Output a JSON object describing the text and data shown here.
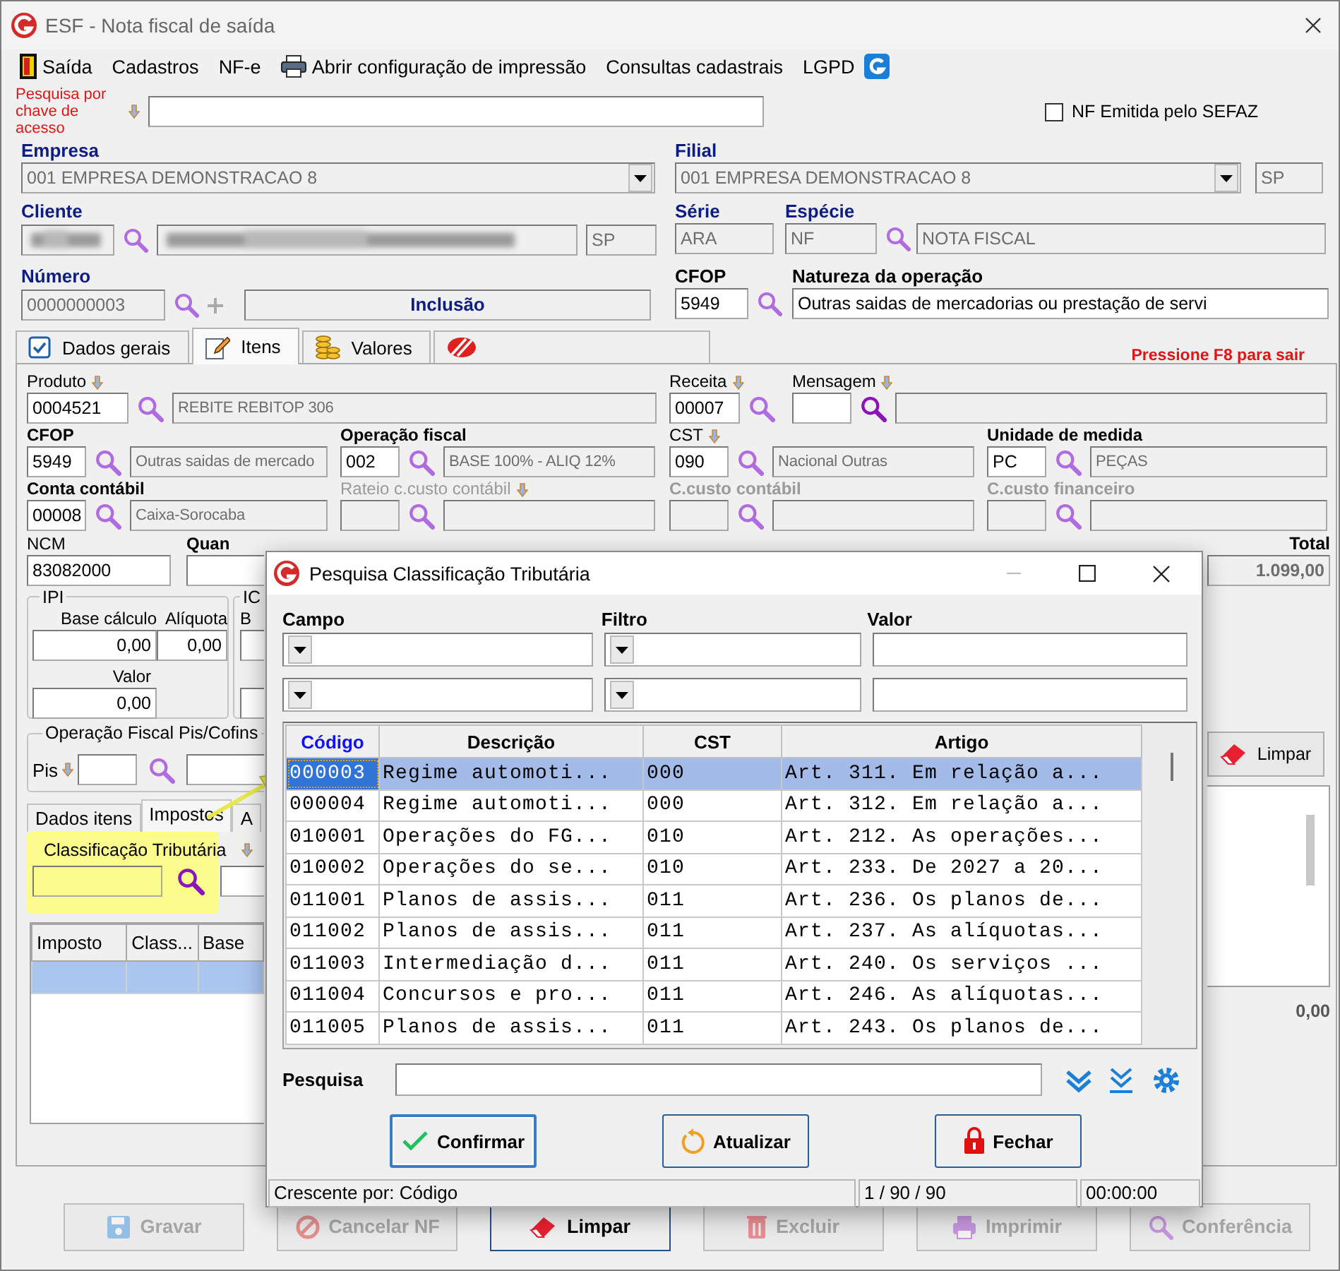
{
  "window": {
    "title": "ESF - Nota fiscal de saída"
  },
  "menu": [
    {
      "label": "Saída",
      "kind": "exit"
    },
    {
      "label": "Cadastros",
      "kind": "plain"
    },
    {
      "label": "NF-e",
      "kind": "plain"
    },
    {
      "label": "Abrir configuração de impressão",
      "kind": "print"
    },
    {
      "label": "Consultas cadastrais",
      "kind": "plain"
    },
    {
      "label": "LGPD",
      "kind": "plain"
    }
  ],
  "access_key": {
    "label": "Pesquisa por chave de acesso"
  },
  "sefaz": {
    "label": "NF Emitida pelo SEFAZ",
    "checked": false
  },
  "empresa": {
    "label": "Empresa",
    "value": "001 EMPRESA DEMONSTRACAO 8"
  },
  "filial": {
    "label": "Filial",
    "value": "001 EMPRESA DEMONSTRACAO 8",
    "uf": "SP"
  },
  "cliente": {
    "label": "Cliente",
    "uf": "SP"
  },
  "serie": {
    "label": "Série",
    "value": "ARA"
  },
  "especie": {
    "label": "Espécie",
    "value": "NF",
    "description": "NOTA FISCAL"
  },
  "numero": {
    "label": "Número",
    "value": "0000000003",
    "status": "Inclusão"
  },
  "cfop": {
    "label": "CFOP",
    "value": "5949"
  },
  "natureza": {
    "label": "Natureza da operação",
    "value": "Outras saidas de mercadorias ou prestação de servi"
  },
  "tabs": [
    {
      "label": "Dados gerais",
      "kind": "check",
      "selected": false
    },
    {
      "label": "Itens",
      "kind": "edit",
      "selected": true
    },
    {
      "label": "Valores",
      "kind": "coins",
      "selected": false
    },
    {
      "kind": "logo",
      "selected": false
    }
  ],
  "hint": "Pressione F8 para sair",
  "item_rows": [
    [
      {
        "label": "Produto",
        "required": false,
        "searchable": true,
        "disabled": false,
        "code": "0004521",
        "description": "REBITE REBITOP 306"
      },
      {
        "label": "Receita",
        "required": false,
        "searchable": true,
        "disabled": false,
        "code": "00007"
      },
      {
        "label": "Mensagem",
        "required": false,
        "searchable": true,
        "disabled": false
      }
    ],
    [
      {
        "label": "CFOP",
        "required": true,
        "searchable": false,
        "disabled": false,
        "code": "5949",
        "description": "Outras saidas de mercado"
      },
      {
        "label": "Operação fiscal",
        "required": true,
        "searchable": false,
        "disabled": false,
        "code": "002",
        "description": "BASE 100% - ALIQ 12%"
      },
      {
        "label": "CST",
        "required": false,
        "searchable": true,
        "disabled": false,
        "code": "090",
        "description": "Nacional Outras"
      },
      {
        "label": "Unidade de medida",
        "required": true,
        "searchable": false,
        "disabled": false,
        "code": "PC",
        "description": "PEÇAS"
      }
    ],
    [
      {
        "label": "Conta contábil",
        "required": true,
        "searchable": false,
        "disabled": false,
        "code": "00008",
        "description": "Caixa-Sorocaba"
      },
      {
        "label": "Rateio c.custo contábil",
        "required": false,
        "searchable": true,
        "disabled": true
      },
      {
        "label": "C.custo contábil",
        "required": true,
        "searchable": false,
        "disabled": true
      },
      {
        "label": "C.custo financeiro",
        "required": true,
        "searchable": false,
        "disabled": true
      }
    ]
  ],
  "ncm": {
    "label": "NCM",
    "value": "83082000"
  },
  "quantity_label": "Quan",
  "total": {
    "label": "Total",
    "value": "1.099,00"
  },
  "ipi": {
    "title": "IPI",
    "base_label": "Base cálculo",
    "base": "0,00",
    "rate_label": "Alíquota",
    "rate": "0,00",
    "value_label": "Valor",
    "value": "0,00"
  },
  "icms": {
    "title": "IC",
    "label": "B"
  },
  "pis_cofins": {
    "title": "Operação Fiscal Pis/Cofins",
    "pis_label": "Pis"
  },
  "clear_button": "Limpar",
  "item_tabs": [
    {
      "label": "Dados itens",
      "selected": false
    },
    {
      "label": "Impostos",
      "selected": true
    },
    {
      "label": "A",
      "selected": false
    }
  ],
  "classification": {
    "label": "Classificação Tributária",
    "highlighted": true
  },
  "tax_grid": {
    "columns": [
      "Imposto",
      "Class...",
      "Base"
    ],
    "rows": [
      {
        "selected": true
      }
    ]
  },
  "footer_total": "0,00",
  "actions": [
    {
      "label": "Gravar",
      "kind": "save",
      "disabled": true
    },
    {
      "label": "Cancelar NF",
      "kind": "cancel",
      "disabled": true
    },
    {
      "label": "Limpar",
      "kind": "clear",
      "disabled": false
    },
    {
      "label": "Excluir",
      "kind": "delete",
      "disabled": true
    },
    {
      "label": "Imprimir",
      "kind": "print",
      "disabled": true
    },
    {
      "label": "Conferência",
      "kind": "search",
      "disabled": true
    }
  ],
  "dialog": {
    "title": "Pesquisa Classificação Tributária",
    "filter_labels": [
      "Campo",
      "Filtro",
      "Valor"
    ],
    "columns": [
      {
        "label": "Código",
        "sorted": true
      },
      {
        "label": "Descrição",
        "sorted": false
      },
      {
        "label": "CST",
        "sorted": false
      },
      {
        "label": "Artigo",
        "sorted": false
      }
    ],
    "rows": [
      {
        "cells": [
          "000003",
          "Regime automoti...",
          "000",
          "Art. 311. Em relação a..."
        ],
        "selected": true
      },
      {
        "cells": [
          "000004",
          "Regime automoti...",
          "000",
          "Art. 312. Em relação a..."
        ],
        "selected": false
      },
      {
        "cells": [
          "010001",
          "Operações do FG...",
          "010",
          "Art. 212. As operações..."
        ],
        "selected": false
      },
      {
        "cells": [
          "010002",
          "Operações do se...",
          "010",
          "Art. 233. De 2027 a 20..."
        ],
        "selected": false
      },
      {
        "cells": [
          "011001",
          "Planos de assis...",
          "011",
          "Art. 236. Os planos de..."
        ],
        "selected": false
      },
      {
        "cells": [
          "011002",
          "Planos de assis...",
          "011",
          "Art. 237. As alíquotas..."
        ],
        "selected": false
      },
      {
        "cells": [
          "011003",
          "Intermediação d...",
          "011",
          "Art. 240. Os serviços ..."
        ],
        "selected": false
      },
      {
        "cells": [
          "011004",
          "Concursos e pro...",
          "011",
          "Art. 246. As alíquotas..."
        ],
        "selected": false
      },
      {
        "cells": [
          "011005",
          "Planos de assis...",
          "011",
          "Art. 243. Os planos de..."
        ],
        "selected": false
      }
    ],
    "search_label": "Pesquisa",
    "buttons": [
      {
        "label": "Confirmar",
        "kind": "confirm",
        "focused": true
      },
      {
        "label": "Atualizar",
        "kind": "refresh",
        "focused": false
      },
      {
        "label": "Fechar",
        "kind": "lock",
        "focused": false
      }
    ],
    "status": [
      "Crescente por: Código",
      "1 / 90 / 90",
      "00:00:00"
    ]
  }
}
